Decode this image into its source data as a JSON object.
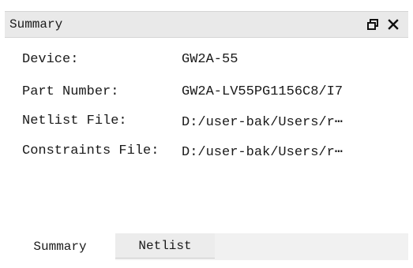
{
  "panel": {
    "title": "Summary",
    "buttons": {
      "float_icon": "float-window-icon",
      "close_icon": "close-icon"
    }
  },
  "summary": {
    "rows": [
      {
        "label": "Device:",
        "value": "GW2A-55"
      },
      {
        "label": "Part Number:",
        "value": "GW2A-LV55PG1156C8/I7"
      },
      {
        "label": "Netlist File:",
        "value": "D:/user-bak/Users/r⋯"
      },
      {
        "label": "Constraints File:",
        "value": "D:/user-bak/Users/r⋯"
      }
    ]
  },
  "tabs": [
    {
      "label": "Summary",
      "active": true
    },
    {
      "label": "Netlist",
      "active": false
    }
  ]
}
